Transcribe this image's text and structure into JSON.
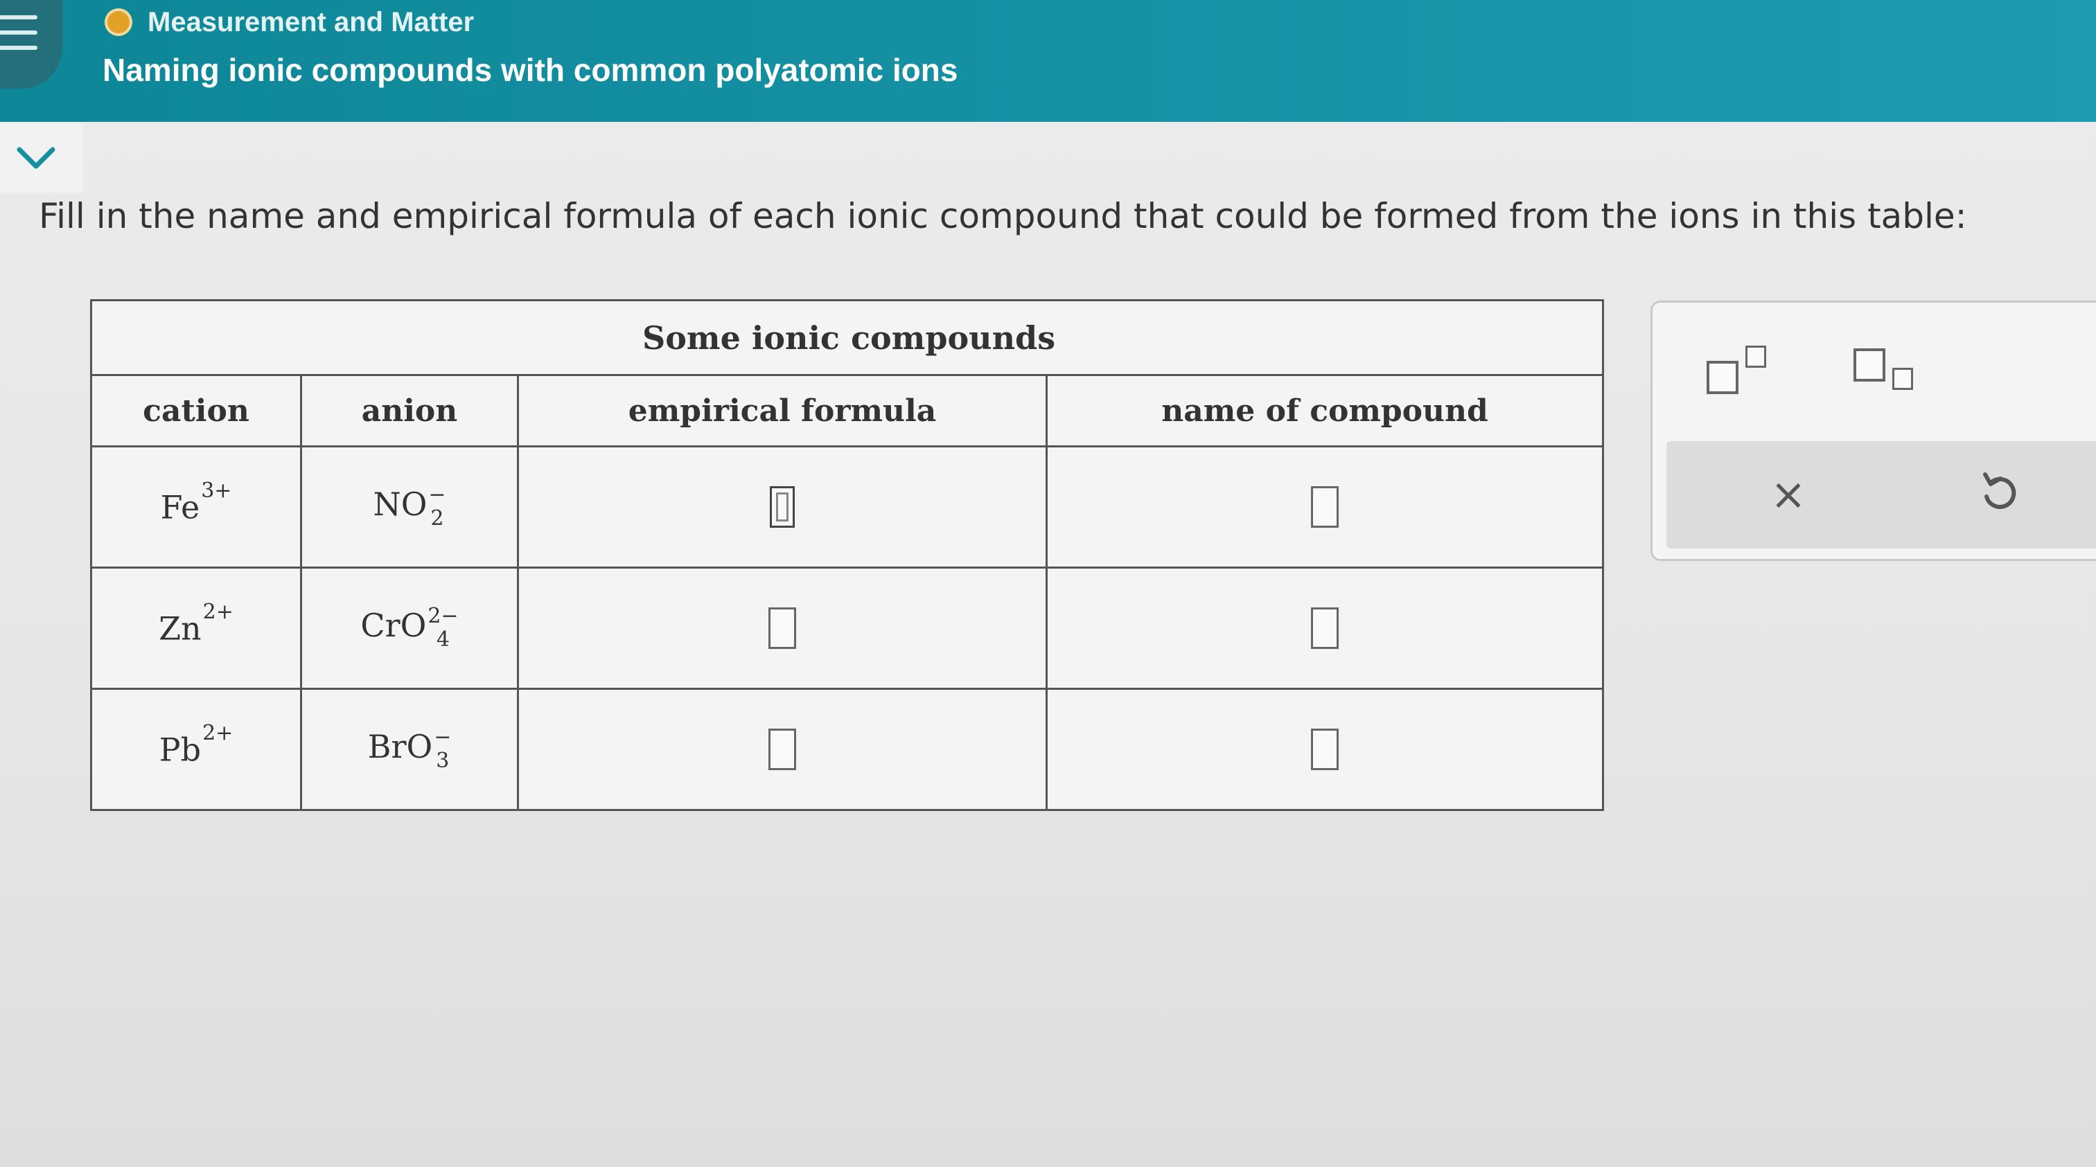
{
  "header": {
    "breadcrumb": "Measurement and Matter",
    "title": "Naming ionic compounds with common polyatomic ions"
  },
  "instruction": "Fill in the name and empirical formula of each ionic compound that could be formed from the ions in this table:",
  "table": {
    "caption": "Some ionic compounds",
    "headers": {
      "cation": "cation",
      "anion": "anion",
      "formula": "empirical formula",
      "name": "name of compound"
    },
    "rows": [
      {
        "cation": {
          "symbol": "Fe",
          "charge": "3+"
        },
        "anion": {
          "symbol": "NO",
          "sub": "2",
          "charge": "−"
        },
        "formula": "",
        "name": ""
      },
      {
        "cation": {
          "symbol": "Zn",
          "charge": "2+"
        },
        "anion": {
          "symbol": "CrO",
          "sub": "4",
          "charge": "2−"
        },
        "formula": "",
        "name": ""
      },
      {
        "cation": {
          "symbol": "Pb",
          "charge": "2+"
        },
        "anion": {
          "symbol": "BrO",
          "sub": "3",
          "charge": "−"
        },
        "formula": "",
        "name": ""
      }
    ]
  },
  "tools": {
    "superscript_icon": "superscript-template-icon",
    "subscript_icon": "subscript-template-icon",
    "clear_label": "×",
    "undo_icon": "undo-icon"
  },
  "colors": {
    "header": "#1590a3",
    "breadcrumb_dot": "#e2a226"
  }
}
